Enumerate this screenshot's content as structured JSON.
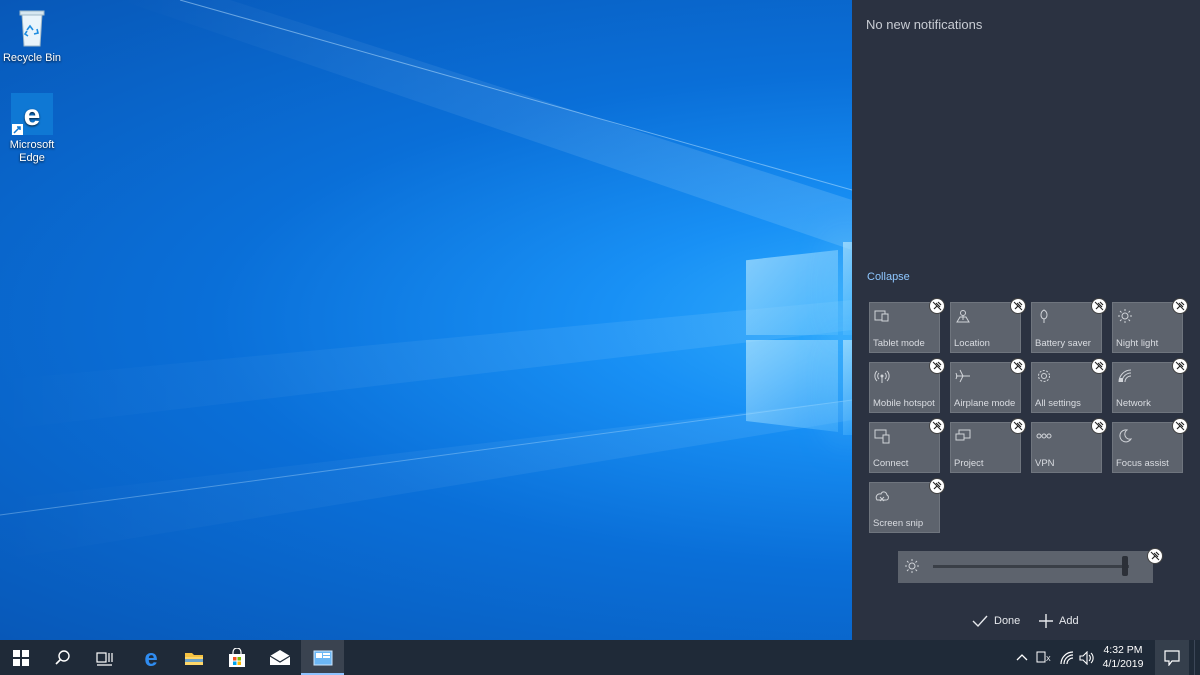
{
  "desktop": {
    "icons": [
      {
        "label_line1": "Recycle Bin",
        "label_line2": "",
        "icon": "recycle-bin-icon"
      },
      {
        "label_line1": "Microsoft",
        "label_line2": "Edge",
        "icon": "edge-icon"
      }
    ]
  },
  "action_center": {
    "no_notifications": "No new notifications",
    "collapse": "Collapse",
    "tiles": [
      {
        "label": "Tablet mode",
        "icon": "tablet-mode-icon"
      },
      {
        "label": "Location",
        "icon": "location-icon"
      },
      {
        "label": "Battery saver",
        "icon": "battery-saver-icon"
      },
      {
        "label": "Night light",
        "icon": "night-light-icon"
      },
      {
        "label": "Mobile hotspot",
        "icon": "mobile-hotspot-icon"
      },
      {
        "label": "Airplane mode",
        "icon": "airplane-icon"
      },
      {
        "label": "All settings",
        "icon": "gear-icon"
      },
      {
        "label": "Network",
        "icon": "network-icon"
      },
      {
        "label": "Connect",
        "icon": "connect-icon"
      },
      {
        "label": "Project",
        "icon": "project-icon"
      },
      {
        "label": "VPN",
        "icon": "vpn-icon"
      },
      {
        "label": "Focus assist",
        "icon": "moon-icon"
      },
      {
        "label": "Screen snip",
        "icon": "screen-snip-icon"
      }
    ],
    "brightness_level": 0.98,
    "done_label": "Done",
    "add_label": "Add"
  },
  "taskbar": {
    "clock_time": "4:32 PM",
    "clock_date": "4/1/2019"
  },
  "colors": {
    "action_center_bg": "#2b3241",
    "tile_bg": "#5d636d",
    "accent": "#8ec7ff",
    "taskbar_bg": "#1f2a38"
  }
}
